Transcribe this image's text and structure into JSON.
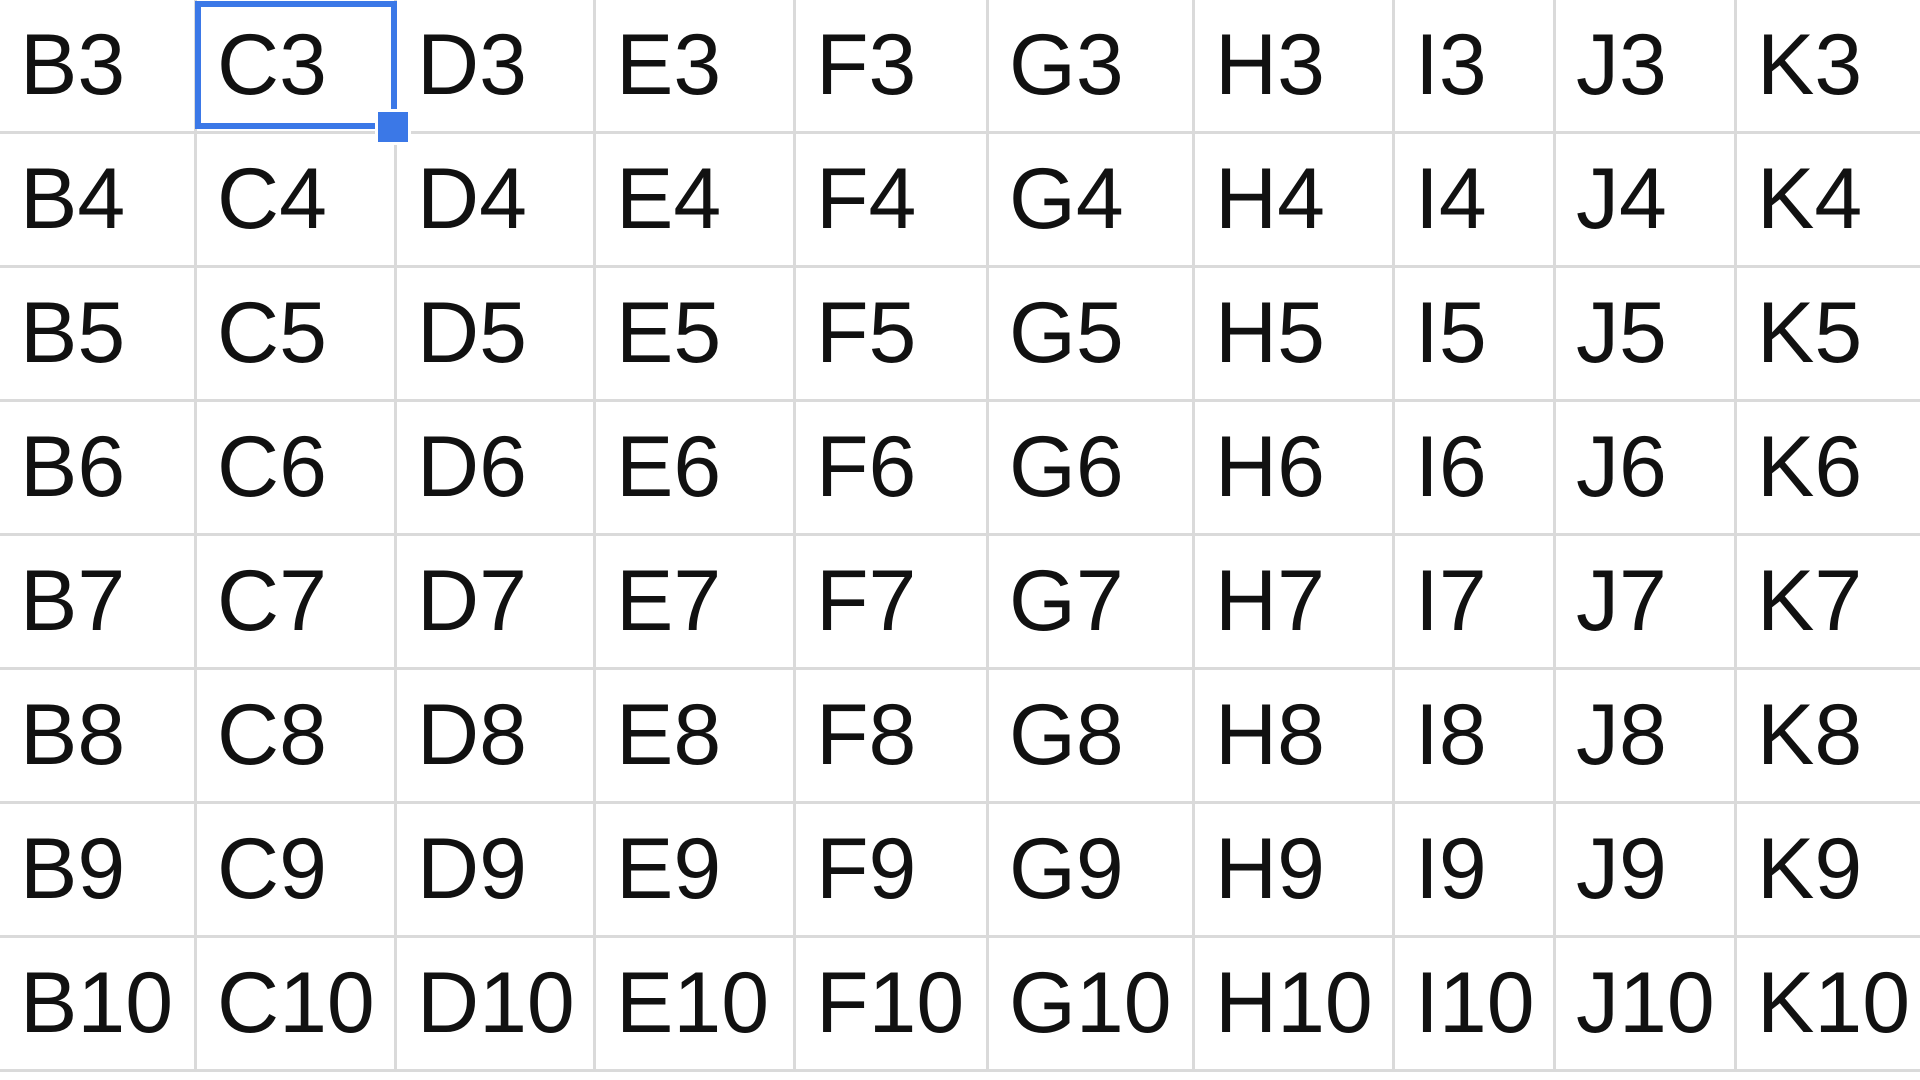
{
  "spreadsheet": {
    "active_cell": "C3",
    "selection_color": "#3b78e7",
    "rows": [
      [
        "B3",
        "C3",
        "D3",
        "E3",
        "F3",
        "G3",
        "H3",
        "I3",
        "J3",
        "K3"
      ],
      [
        "B4",
        "C4",
        "D4",
        "E4",
        "F4",
        "G4",
        "H4",
        "I4",
        "J4",
        "K4"
      ],
      [
        "B5",
        "C5",
        "D5",
        "E5",
        "F5",
        "G5",
        "H5",
        "I5",
        "J5",
        "K5"
      ],
      [
        "B6",
        "C6",
        "D6",
        "E6",
        "F6",
        "G6",
        "H6",
        "I6",
        "J6",
        "K6"
      ],
      [
        "B7",
        "C7",
        "D7",
        "E7",
        "F7",
        "G7",
        "H7",
        "I7",
        "J7",
        "K7"
      ],
      [
        "B8",
        "C8",
        "D8",
        "E8",
        "F8",
        "G8",
        "H8",
        "I8",
        "J8",
        "K8"
      ],
      [
        "B9",
        "C9",
        "D9",
        "E9",
        "F9",
        "G9",
        "H9",
        "I9",
        "J9",
        "K9"
      ],
      [
        "B10",
        "C10",
        "D10",
        "E10",
        "F10",
        "G10",
        "H10",
        "I10",
        "J10",
        "K10"
      ]
    ]
  }
}
